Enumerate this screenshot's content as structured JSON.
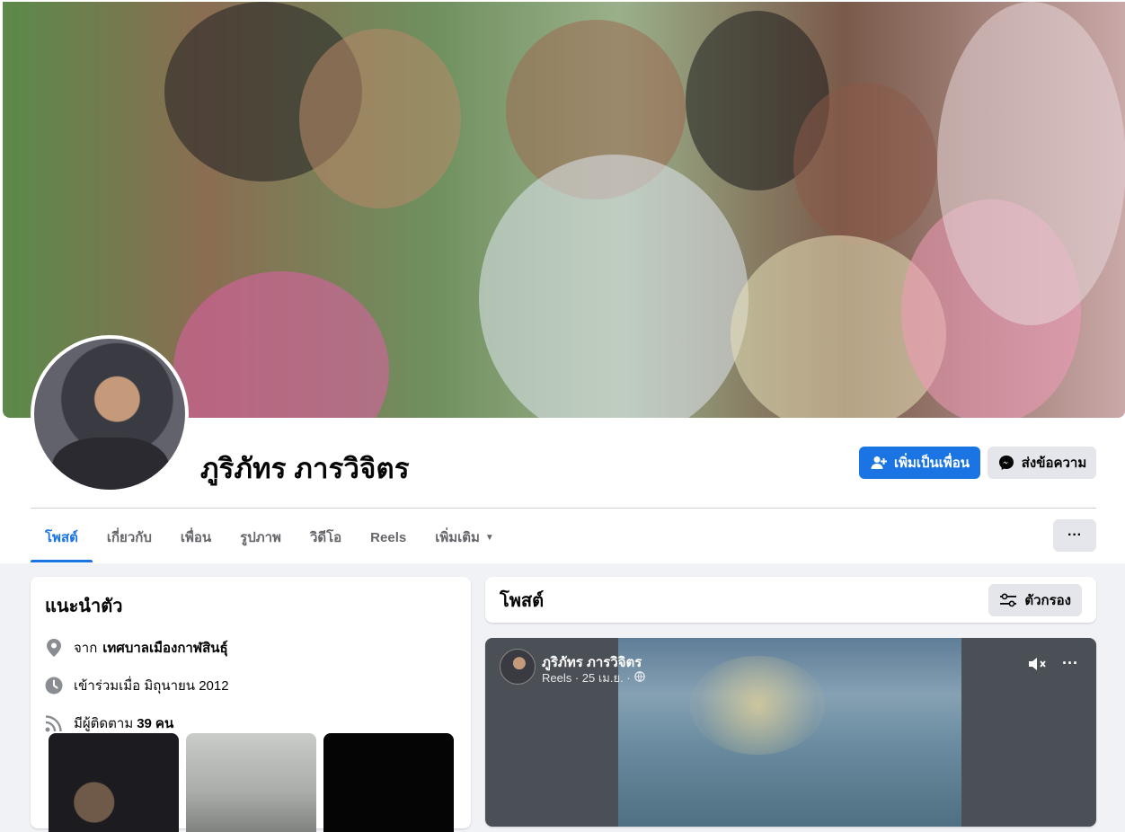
{
  "profile": {
    "name": "ภูริภัทร ภารวิจิตร"
  },
  "actions": {
    "add_friend": "เพิ่มเป็นเพื่อน",
    "message": "ส่งข้อความ"
  },
  "tabs": [
    {
      "label": "โพสต์"
    },
    {
      "label": "เกี่ยวกับ"
    },
    {
      "label": "เพื่อน"
    },
    {
      "label": "รูปภาพ"
    },
    {
      "label": "วิดีโอ"
    },
    {
      "label": "Reels"
    },
    {
      "label": "เพิ่มเติม"
    }
  ],
  "more_menu": "···",
  "intro": {
    "title": "แนะนำตัว",
    "from_prefix": "จาก",
    "from_place": "เทศบาลเมืองกาฬสินธุ์",
    "joined": "เข้าร่วมเมื่อ มิถุนายน 2012",
    "followers_prefix": "มีผู้ติดตาม",
    "followers_count": "39",
    "followers_suffix": "คน"
  },
  "posts": {
    "title": "โพสต์",
    "filter_label": "ตัวกรอง"
  },
  "post": {
    "author": "ภูริภัทร ภารวิจิตร",
    "meta": "Reels · 25 เม.ย. ·",
    "menu": "···"
  },
  "colors": {
    "accent": "#1b74e4",
    "secondary_button": "#e4e6eb",
    "page_bg": "#f0f2f5"
  }
}
